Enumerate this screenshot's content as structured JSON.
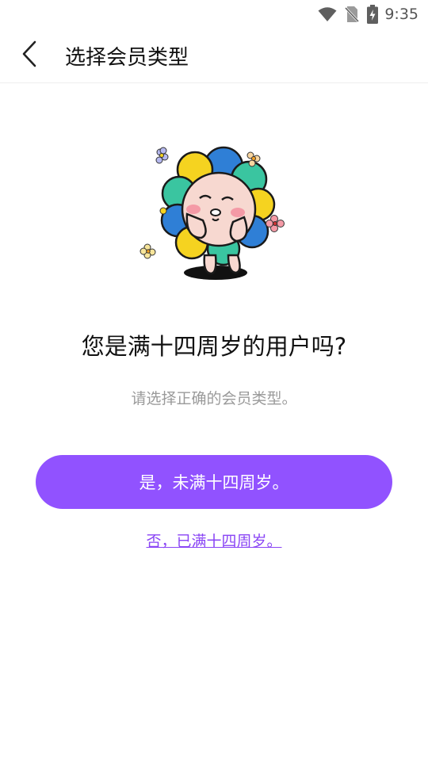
{
  "status_bar": {
    "time": "9:35",
    "icons": [
      "wifi-icon",
      "no-sim-icon",
      "battery-charging-icon"
    ]
  },
  "app_bar": {
    "back_icon": "chevron-left-icon",
    "title": "选择会员类型"
  },
  "main": {
    "illustration": "flower-character-illustration",
    "question": "您是满十四周岁的用户吗?",
    "hint": "请选择正确的会员类型。",
    "primary_button_label": "是，未满十四周岁。",
    "secondary_link_label": "否，已满十四周岁。"
  },
  "colors": {
    "accent": "#9152ff",
    "link": "#8a45f5",
    "hint_text": "#9a9a9a"
  }
}
